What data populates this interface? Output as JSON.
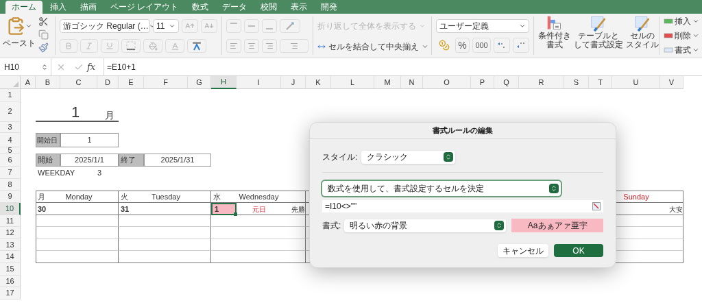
{
  "tabs": [
    {
      "label": "ホーム",
      "selected": true
    },
    {
      "label": "挿入",
      "selected": false
    },
    {
      "label": "描画",
      "selected": false
    },
    {
      "label": "ページ レイアウト",
      "selected": false
    },
    {
      "label": "数式",
      "selected": false
    },
    {
      "label": "データ",
      "selected": false
    },
    {
      "label": "校閲",
      "selected": false
    },
    {
      "label": "表示",
      "selected": false
    },
    {
      "label": "開発",
      "selected": false
    }
  ],
  "ribbon": {
    "paste_label": "ペースト",
    "font_name": "游ゴシック Regular (…",
    "font_size": "11",
    "font_style_disabled": true,
    "wrap_text": {
      "label": "折り返して全体を表示する",
      "disabled": true
    },
    "merge_center": {
      "label": "セルを結合して中央揃え",
      "disabled": false
    },
    "number_format": "ユーザー定義",
    "percent": "%",
    "thousands": "000",
    "styles": [
      [
        "条件付き",
        "書式"
      ],
      [
        "テーブルと",
        "して書式設定"
      ],
      [
        "セルの",
        "スタイル"
      ]
    ],
    "cells": [
      "挿入",
      "削除",
      "書式"
    ]
  },
  "formula_bar": {
    "name_box": "H10",
    "function_label": "fx",
    "formula": "=E10+1"
  },
  "columns": [
    {
      "label": "A",
      "selected": false
    },
    {
      "label": "B",
      "selected": false
    },
    {
      "label": "C",
      "selected": false
    },
    {
      "label": "D",
      "selected": false
    },
    {
      "label": "E",
      "selected": false
    },
    {
      "label": "F",
      "selected": false
    },
    {
      "label": "G",
      "selected": false
    },
    {
      "label": "H",
      "selected": true
    },
    {
      "label": "I",
      "selected": false
    },
    {
      "label": "J",
      "selected": false
    },
    {
      "label": "K",
      "selected": false
    },
    {
      "label": "L",
      "selected": false
    },
    {
      "label": "M",
      "selected": false
    },
    {
      "label": "N",
      "selected": false
    },
    {
      "label": "O",
      "selected": false
    },
    {
      "label": "P",
      "selected": false
    },
    {
      "label": "Q",
      "selected": false
    },
    {
      "label": "R",
      "selected": false
    },
    {
      "label": "S",
      "selected": false
    },
    {
      "label": "T",
      "selected": false
    },
    {
      "label": "U",
      "selected": false
    },
    {
      "label": "V",
      "selected": false
    }
  ],
  "rows": [
    {
      "label": "1",
      "selected": false
    },
    {
      "label": "2",
      "selected": false
    },
    {
      "label": "3",
      "selected": false
    },
    {
      "label": "4",
      "selected": false
    },
    {
      "label": "5",
      "selected": false
    },
    {
      "label": "6",
      "selected": false
    },
    {
      "label": "7",
      "selected": false
    },
    {
      "label": "8",
      "selected": false
    },
    {
      "label": "9",
      "selected": false
    },
    {
      "label": "10",
      "selected": true
    },
    {
      "label": "11",
      "selected": false
    },
    {
      "label": "12",
      "selected": false
    },
    {
      "label": "13",
      "selected": false
    },
    {
      "label": "14",
      "selected": false
    },
    {
      "label": "15",
      "selected": false
    },
    {
      "label": "16",
      "selected": false
    },
    {
      "label": "17",
      "selected": false
    }
  ],
  "sheet": {
    "month": "1",
    "month_unit": "月",
    "start_day_label": "開始日",
    "start_day": "1",
    "start_label": "開始",
    "start_date": "2025/1/1",
    "end_label": "終了",
    "end_date": "2025/1/31",
    "weekday_label": "WEEKDAY",
    "weekday": "3"
  },
  "calendar": [
    {
      "kanji": "月",
      "name": "Monday",
      "color": "#333333",
      "date": "30",
      "highlighted": false,
      "selected": false
    },
    {
      "kanji": "火",
      "name": "Tuesday",
      "color": "#333333",
      "date": "31",
      "highlighted": false,
      "selected": false
    },
    {
      "kanji": "水",
      "name": "Wednesday",
      "color": "#333333",
      "date": "1",
      "highlighted": true,
      "selected": true,
      "holiday": "元日",
      "rokuyo": "先勝"
    },
    {
      "name": "Sunday",
      "color": "#d0202a",
      "rokuyo": "大安"
    }
  ],
  "dialog": {
    "title": "書式ルールの編集",
    "style_label": "スタイル:",
    "style_value": "クラシック",
    "rule_type": "数式を使用して、書式設定するセルを決定",
    "formula": "=I10<>\"\"",
    "format_label": "書式:",
    "format_value": "明るい赤の背景",
    "preview": "Aaあぁアァ亜宇",
    "buttons": [
      {
        "label": "キャンセル",
        "kind": "secondary"
      },
      {
        "label": "OK",
        "kind": "primary"
      }
    ]
  }
}
